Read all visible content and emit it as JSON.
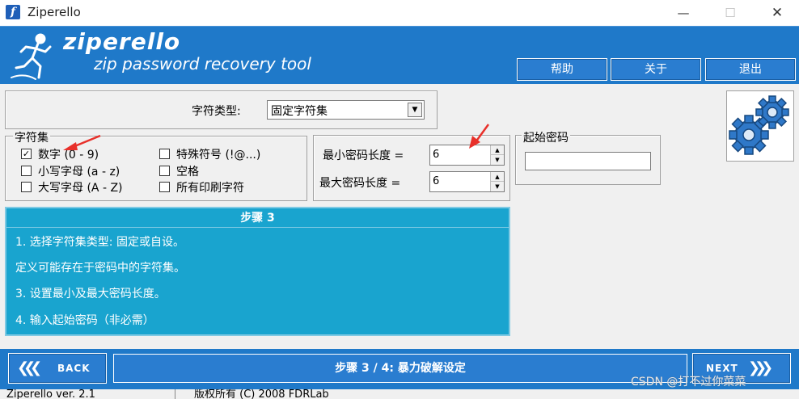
{
  "window": {
    "title": "Ziperello",
    "minimize_glyph": "—",
    "maximize_glyph": "☐",
    "close_glyph": "✕",
    "app_icon_letter": "f"
  },
  "banner": {
    "brand": "ziperello",
    "tagline": "zip password recovery tool",
    "buttons": {
      "help": "帮助",
      "about": "关于",
      "exit": "退出"
    }
  },
  "charset_type": {
    "label": "字符类型:",
    "value": "固定字符集",
    "arrow_glyph": "▼"
  },
  "charset": {
    "legend": "字符集",
    "options": [
      {
        "label": "数字 (0 - 9)",
        "checked": true
      },
      {
        "label": "小写字母 (a - z)",
        "checked": false
      },
      {
        "label": "大写字母 (A - Z)",
        "checked": false
      },
      {
        "label": "特殊符号 (!@...)",
        "checked": false
      },
      {
        "label": "空格",
        "checked": false
      },
      {
        "label": "所有印刷字符",
        "checked": false
      }
    ],
    "check_glyph": "✓"
  },
  "length": {
    "min_label": "最小密码长度 =",
    "min_value": "6",
    "max_label": "最大密码长度 =",
    "max_value": "6",
    "up_glyph": "▲",
    "down_glyph": "▼"
  },
  "start_password": {
    "legend": "起始密码",
    "value": ""
  },
  "step": {
    "header": "步骤 3",
    "lines": [
      "1. 选择字符集类型: 固定或自设。",
      "定义可能存在于密码中的字符集。",
      "3. 设置最小及最大密码长度。",
      "4. 输入起始密码（非必需）"
    ]
  },
  "nav": {
    "back": "BACK",
    "next": "NEXT",
    "back_chevrons": "❮❮❮",
    "next_chevrons": "❯❯❯",
    "progress": "步骤 3 / 4: 暴力破解设定"
  },
  "status": {
    "version": "Ziperello ver. 2.1",
    "copyright": "版权所有 (C) 2008 FDRLab"
  },
  "watermark": "CSDN @打不过你菜菜",
  "colors": {
    "banner_blue": "#1f79c9",
    "step_cyan": "#19a4cf",
    "annotation_red": "#e8302a"
  },
  "icons": {
    "logo": "running-man-logo-icon",
    "gears": "gears-icon",
    "annotation": "red-arrow-annotation-icon"
  }
}
